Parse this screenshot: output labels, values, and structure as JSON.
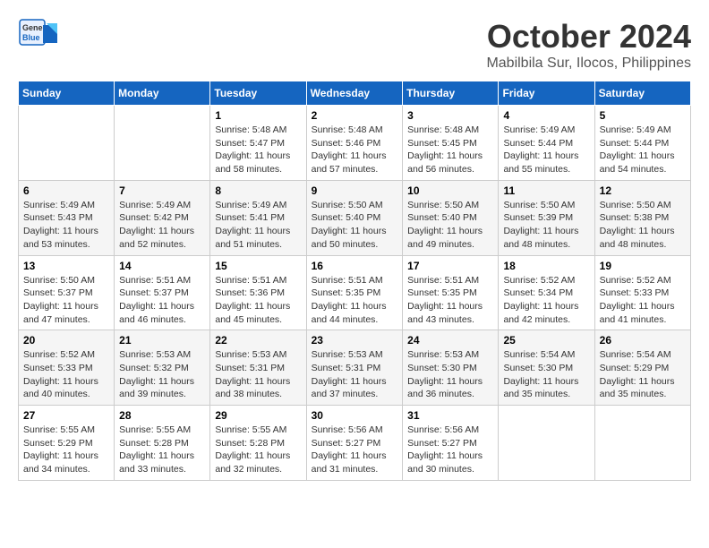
{
  "header": {
    "logo_line1": "General",
    "logo_line2": "Blue",
    "month": "October 2024",
    "location": "Mabilbila Sur, Ilocos, Philippines"
  },
  "weekdays": [
    "Sunday",
    "Monday",
    "Tuesday",
    "Wednesday",
    "Thursday",
    "Friday",
    "Saturday"
  ],
  "weeks": [
    [
      {
        "day": "",
        "info": ""
      },
      {
        "day": "",
        "info": ""
      },
      {
        "day": "1",
        "info": "Sunrise: 5:48 AM\nSunset: 5:47 PM\nDaylight: 11 hours and 58 minutes."
      },
      {
        "day": "2",
        "info": "Sunrise: 5:48 AM\nSunset: 5:46 PM\nDaylight: 11 hours and 57 minutes."
      },
      {
        "day": "3",
        "info": "Sunrise: 5:48 AM\nSunset: 5:45 PM\nDaylight: 11 hours and 56 minutes."
      },
      {
        "day": "4",
        "info": "Sunrise: 5:49 AM\nSunset: 5:44 PM\nDaylight: 11 hours and 55 minutes."
      },
      {
        "day": "5",
        "info": "Sunrise: 5:49 AM\nSunset: 5:44 PM\nDaylight: 11 hours and 54 minutes."
      }
    ],
    [
      {
        "day": "6",
        "info": "Sunrise: 5:49 AM\nSunset: 5:43 PM\nDaylight: 11 hours and 53 minutes."
      },
      {
        "day": "7",
        "info": "Sunrise: 5:49 AM\nSunset: 5:42 PM\nDaylight: 11 hours and 52 minutes."
      },
      {
        "day": "8",
        "info": "Sunrise: 5:49 AM\nSunset: 5:41 PM\nDaylight: 11 hours and 51 minutes."
      },
      {
        "day": "9",
        "info": "Sunrise: 5:50 AM\nSunset: 5:40 PM\nDaylight: 11 hours and 50 minutes."
      },
      {
        "day": "10",
        "info": "Sunrise: 5:50 AM\nSunset: 5:40 PM\nDaylight: 11 hours and 49 minutes."
      },
      {
        "day": "11",
        "info": "Sunrise: 5:50 AM\nSunset: 5:39 PM\nDaylight: 11 hours and 48 minutes."
      },
      {
        "day": "12",
        "info": "Sunrise: 5:50 AM\nSunset: 5:38 PM\nDaylight: 11 hours and 48 minutes."
      }
    ],
    [
      {
        "day": "13",
        "info": "Sunrise: 5:50 AM\nSunset: 5:37 PM\nDaylight: 11 hours and 47 minutes."
      },
      {
        "day": "14",
        "info": "Sunrise: 5:51 AM\nSunset: 5:37 PM\nDaylight: 11 hours and 46 minutes."
      },
      {
        "day": "15",
        "info": "Sunrise: 5:51 AM\nSunset: 5:36 PM\nDaylight: 11 hours and 45 minutes."
      },
      {
        "day": "16",
        "info": "Sunrise: 5:51 AM\nSunset: 5:35 PM\nDaylight: 11 hours and 44 minutes."
      },
      {
        "day": "17",
        "info": "Sunrise: 5:51 AM\nSunset: 5:35 PM\nDaylight: 11 hours and 43 minutes."
      },
      {
        "day": "18",
        "info": "Sunrise: 5:52 AM\nSunset: 5:34 PM\nDaylight: 11 hours and 42 minutes."
      },
      {
        "day": "19",
        "info": "Sunrise: 5:52 AM\nSunset: 5:33 PM\nDaylight: 11 hours and 41 minutes."
      }
    ],
    [
      {
        "day": "20",
        "info": "Sunrise: 5:52 AM\nSunset: 5:33 PM\nDaylight: 11 hours and 40 minutes."
      },
      {
        "day": "21",
        "info": "Sunrise: 5:53 AM\nSunset: 5:32 PM\nDaylight: 11 hours and 39 minutes."
      },
      {
        "day": "22",
        "info": "Sunrise: 5:53 AM\nSunset: 5:31 PM\nDaylight: 11 hours and 38 minutes."
      },
      {
        "day": "23",
        "info": "Sunrise: 5:53 AM\nSunset: 5:31 PM\nDaylight: 11 hours and 37 minutes."
      },
      {
        "day": "24",
        "info": "Sunrise: 5:53 AM\nSunset: 5:30 PM\nDaylight: 11 hours and 36 minutes."
      },
      {
        "day": "25",
        "info": "Sunrise: 5:54 AM\nSunset: 5:30 PM\nDaylight: 11 hours and 35 minutes."
      },
      {
        "day": "26",
        "info": "Sunrise: 5:54 AM\nSunset: 5:29 PM\nDaylight: 11 hours and 35 minutes."
      }
    ],
    [
      {
        "day": "27",
        "info": "Sunrise: 5:55 AM\nSunset: 5:29 PM\nDaylight: 11 hours and 34 minutes."
      },
      {
        "day": "28",
        "info": "Sunrise: 5:55 AM\nSunset: 5:28 PM\nDaylight: 11 hours and 33 minutes."
      },
      {
        "day": "29",
        "info": "Sunrise: 5:55 AM\nSunset: 5:28 PM\nDaylight: 11 hours and 32 minutes."
      },
      {
        "day": "30",
        "info": "Sunrise: 5:56 AM\nSunset: 5:27 PM\nDaylight: 11 hours and 31 minutes."
      },
      {
        "day": "31",
        "info": "Sunrise: 5:56 AM\nSunset: 5:27 PM\nDaylight: 11 hours and 30 minutes."
      },
      {
        "day": "",
        "info": ""
      },
      {
        "day": "",
        "info": ""
      }
    ]
  ]
}
